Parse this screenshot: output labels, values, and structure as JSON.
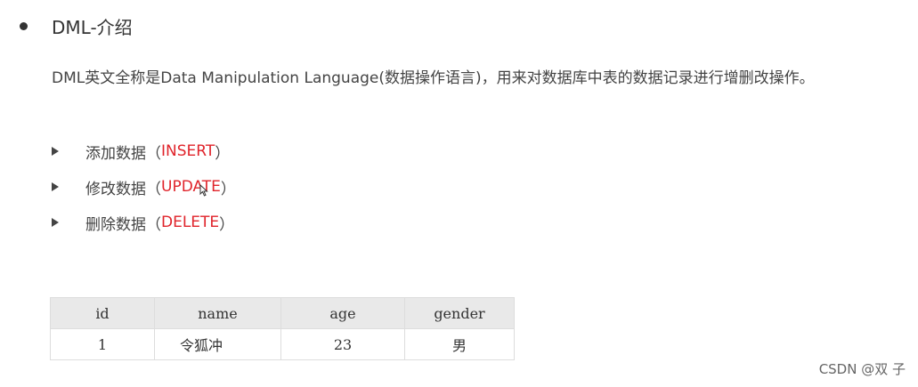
{
  "heading": "DML-介绍",
  "description": "DML英文全称是Data Manipulation Language(数据操作语言)，用来对数据库中表的数据记录进行增删改操作。",
  "operations": [
    {
      "label": "添加数据（",
      "code": "INSERT",
      "suffix": "）"
    },
    {
      "label": "修改数据（",
      "code": "UPDATE",
      "suffix": "）"
    },
    {
      "label": "删除数据（",
      "code": "DELETE",
      "suffix": "）"
    }
  ],
  "table": {
    "headers": [
      "id",
      "name",
      "age",
      "gender"
    ],
    "rows": [
      [
        "1",
        "令狐冲",
        "23",
        "男"
      ]
    ]
  },
  "watermark": "CSDN @双 子",
  "colors": {
    "accent_red": "#e0242b",
    "text": "#333333",
    "header_bg": "#e9e9e9"
  }
}
